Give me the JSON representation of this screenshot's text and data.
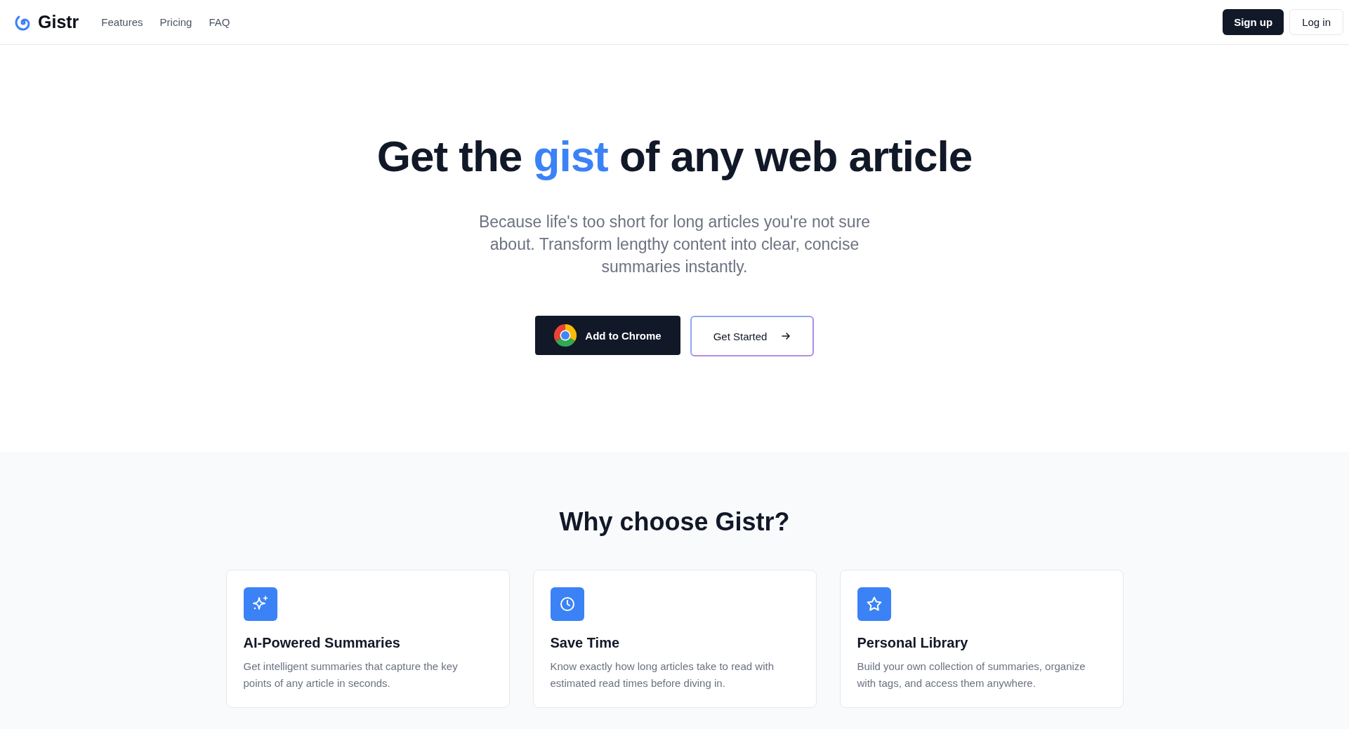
{
  "header": {
    "logo": "Gistr",
    "nav": [
      "Features",
      "Pricing",
      "FAQ"
    ],
    "signup": "Sign up",
    "login": "Log in"
  },
  "hero": {
    "title_parts": [
      {
        "text": "Get the ",
        "highlight": false
      },
      {
        "text": "gist",
        "highlight": true
      },
      {
        "text": " of any web article",
        "highlight": false
      }
    ],
    "subtitle": "Because life's too short for long articles you're not sure about. Transform lengthy content into clear, concise summaries instantly.",
    "primary_button": "Add to Chrome",
    "secondary_button": "Get Started"
  },
  "features": {
    "heading": "Why choose Gistr?",
    "cards": [
      {
        "kind": "sparkles",
        "title": "AI-Powered Summaries",
        "description": "Get intelligent summaries that capture the key points of any article in seconds."
      },
      {
        "kind": "clock",
        "title": "Save Time",
        "description": "Know exactly how long articles take to read with estimated read times before diving in."
      },
      {
        "kind": "star",
        "title": "Personal Library",
        "description": "Build your own collection of summaries, organize with tags, and access them anywhere."
      }
    ]
  }
}
